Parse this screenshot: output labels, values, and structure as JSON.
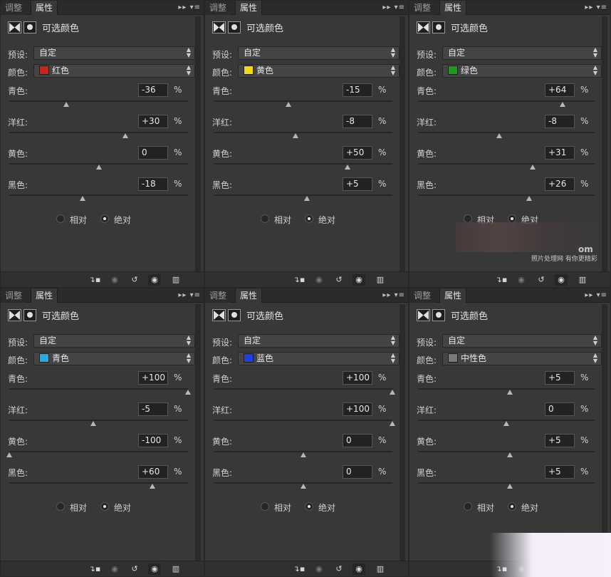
{
  "tabs": {
    "adjust": "调整",
    "properties": "属性"
  },
  "header": {
    "title": "可选颜色"
  },
  "labels": {
    "preset": "预设:",
    "color": "颜色:",
    "relative": "相对",
    "absolute": "绝对",
    "percent": "%"
  },
  "sliders_labels": [
    "青色:",
    "洋红:",
    "黄色:",
    "黑色:"
  ],
  "panels": [
    {
      "preset": "自定",
      "color_name": "红色",
      "swatch": "#c8261c",
      "values": [
        "-36",
        "+30",
        "0",
        "-18"
      ],
      "fractions": [
        0.32,
        0.65,
        0.5,
        0.41
      ],
      "mode": "absolute"
    },
    {
      "preset": "自定",
      "color_name": "黄色",
      "swatch": "#f1d71a",
      "values": [
        "-15",
        "-8",
        "+50",
        "+5"
      ],
      "fractions": [
        0.42,
        0.46,
        0.75,
        0.52
      ],
      "mode": "absolute"
    },
    {
      "preset": "自定",
      "color_name": "绿色",
      "swatch": "#1f9a1c",
      "values": [
        "+64",
        "-8",
        "+31",
        "+26"
      ],
      "fractions": [
        0.82,
        0.46,
        0.65,
        0.63
      ],
      "mode": "absolute"
    },
    {
      "preset": "自定",
      "color_name": "青色",
      "swatch": "#29a9e0",
      "values": [
        "+100",
        "-5",
        "-100",
        "+60"
      ],
      "fractions": [
        1.0,
        0.47,
        0.0,
        0.8
      ],
      "mode": "absolute"
    },
    {
      "preset": "自定",
      "color_name": "蓝色",
      "swatch": "#1f3fe0",
      "values": [
        "+100",
        "+100",
        "0",
        "0"
      ],
      "fractions": [
        1.0,
        1.0,
        0.5,
        0.5
      ],
      "mode": "absolute"
    },
    {
      "preset": "自定",
      "color_name": "中性色",
      "swatch": "#7a7a7a",
      "values": [
        "+5",
        "0",
        "+5",
        "+5"
      ],
      "fractions": [
        0.52,
        0.5,
        0.52,
        0.52
      ],
      "mode": "absolute"
    }
  ],
  "watermark": {
    "site": "照片处理网 有你更精彩",
    "logo": "om"
  },
  "icons": [
    "adjustment-layer-icon",
    "mask-icon",
    "clip-to-layer-icon",
    "view-previous-icon",
    "reset-icon",
    "visibility-eye-icon",
    "trash-icon",
    "panel-menu-icon",
    "collapse-icon"
  ]
}
